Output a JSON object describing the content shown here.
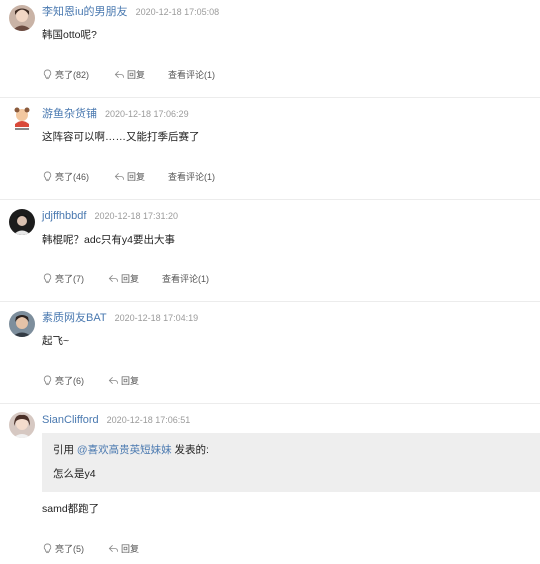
{
  "comments": [
    {
      "username": "李知恩iu的男朋友",
      "time": "2020-12-18 17:05:08",
      "content": "韩国otto呢?",
      "like": "亮了(82)",
      "reply": "回复",
      "view": "查看评论(1)"
    },
    {
      "username": "游鱼杂货铺",
      "time": "2020-12-18 17:06:29",
      "content": "这阵容可以啊……又能打季后赛了",
      "like": "亮了(46)",
      "reply": "回复",
      "view": "查看评论(1)"
    },
    {
      "username": "jdjffhbbdf",
      "time": "2020-12-18 17:31:20",
      "content": "韩棍呢？adc只有y4要出大事",
      "like": "亮了(7)",
      "reply": "回复",
      "view": "查看评论(1)"
    },
    {
      "username": "素质网友BAT",
      "time": "2020-12-18 17:04:19",
      "content": "起飞~",
      "like": "亮了(6)",
      "reply": "回复"
    },
    {
      "username": "SianClifford",
      "time": "2020-12-18 17:06:51",
      "quote": {
        "prefix": "引用 ",
        "user": "@喜欢高贵英短妹妹",
        "suffix": " 发表的:",
        "text": "怎么是y4"
      },
      "content": "samd都跑了",
      "like": "亮了(5)",
      "reply": "回复"
    }
  ]
}
